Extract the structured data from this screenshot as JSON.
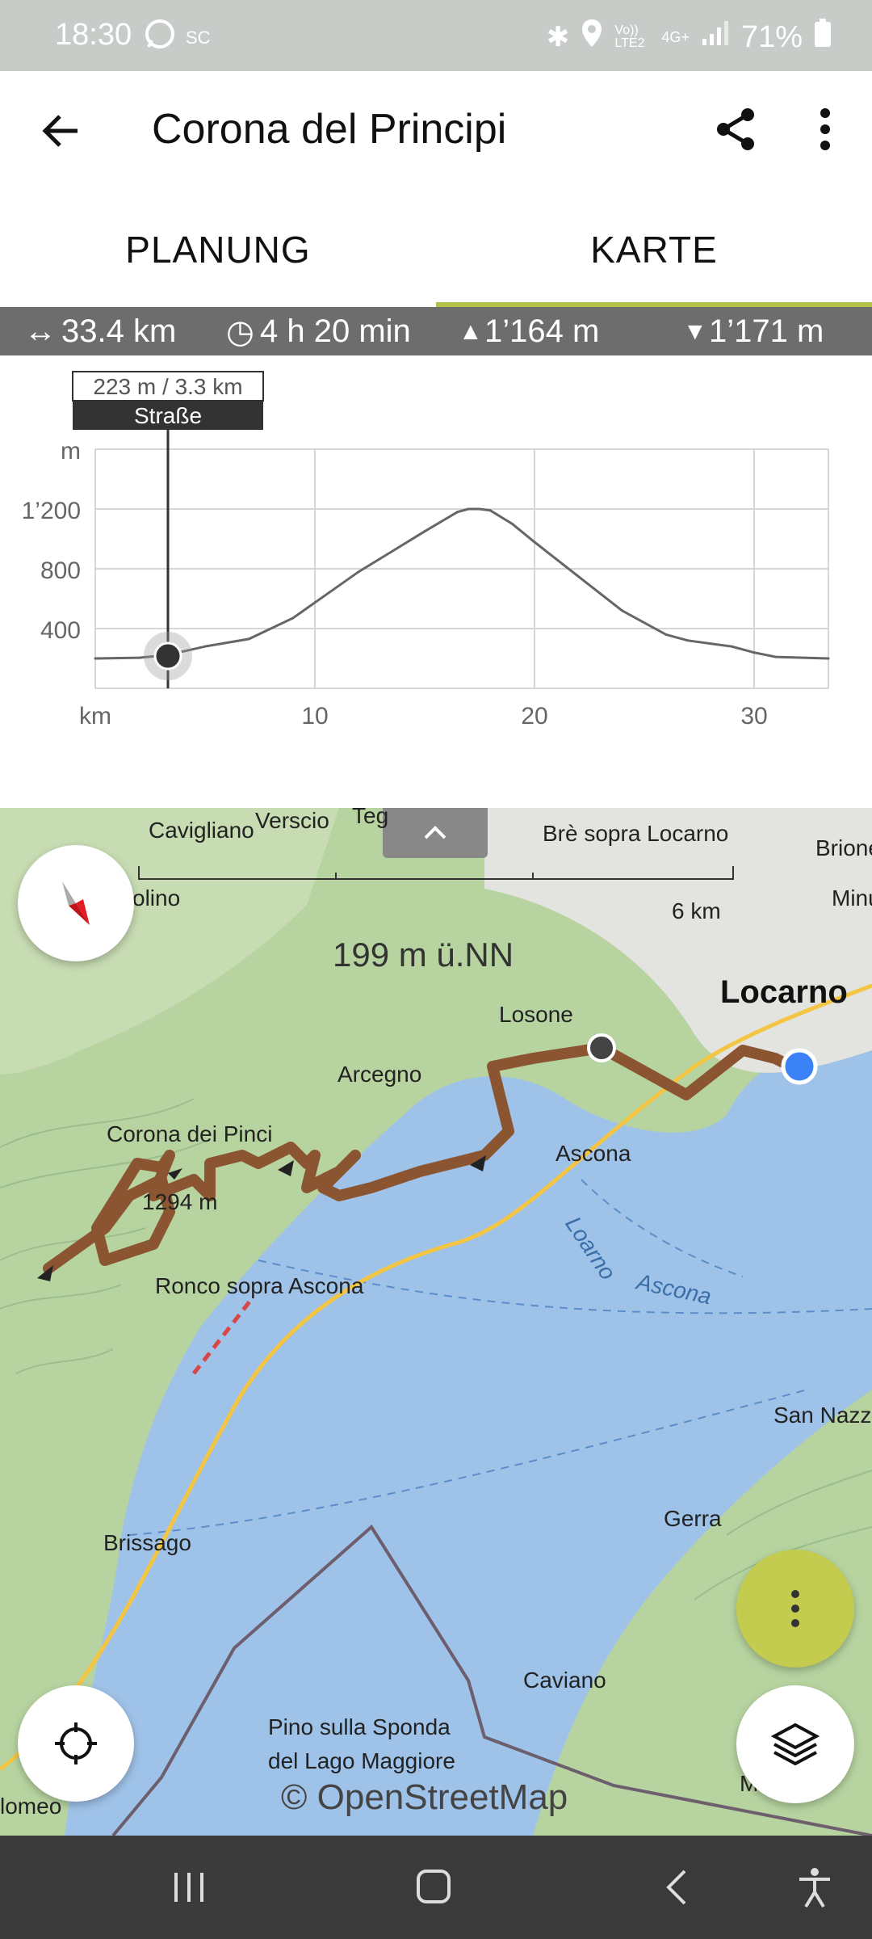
{
  "status": {
    "time": "18:30",
    "sc": "SC",
    "network": "Vo)) LTE2",
    "net2": "4G+",
    "battery": "71%"
  },
  "appbar": {
    "title": "Corona del Principi"
  },
  "tabs": [
    {
      "label": "PLANUNG"
    },
    {
      "label": "KARTE"
    }
  ],
  "stats": {
    "distance": "33.4 km",
    "duration": "4 h 20 min",
    "ascent": "1’164 m",
    "descent": "1’171 m"
  },
  "profile": {
    "tooltip_value": "223 m / 3.3 km",
    "tooltip_surface": "Straße",
    "y_unit": "m",
    "y_ticks": [
      "1’200",
      "800",
      "400"
    ],
    "x_unit": "km",
    "x_ticks": [
      "10",
      "20",
      "30"
    ]
  },
  "chart_data": {
    "type": "line",
    "xlabel": "km",
    "ylabel": "m",
    "xlim": [
      0,
      33.4
    ],
    "ylim": [
      0,
      1500
    ],
    "x": [
      0,
      2,
      3.3,
      5,
      7,
      9,
      12,
      15,
      16.5,
      17,
      17.5,
      18,
      19,
      20,
      22,
      24,
      26,
      27,
      29,
      30,
      31,
      33.4
    ],
    "y": [
      200,
      205,
      223,
      280,
      330,
      470,
      780,
      1050,
      1180,
      1200,
      1200,
      1190,
      1100,
      980,
      750,
      520,
      360,
      320,
      280,
      240,
      210,
      200
    ],
    "grid": true
  },
  "map": {
    "altitude_label": "199 m ü.NN",
    "scale_label": "6 km",
    "places": {
      "cavigliano": "Cavigliano",
      "verscio": "Verscio",
      "tegna": "Teg",
      "bre": "Brè sopra Locarno",
      "brione": "Brione",
      "minusio": "Minu",
      "olino": "olino",
      "locarno": "Locarno",
      "losone": "Losone",
      "arcegno": "Arcegno",
      "corona": "Corona dei Pinci",
      "peak": "1294 m",
      "ascona": "Ascona",
      "ronco": "Ronco sopra Ascona",
      "lake1": "Loarno",
      "lake2": "Ascona",
      "sannazzaro": "San Nazza",
      "gerra": "Gerra",
      "brissago": "Brissago",
      "caviano": "Caviano",
      "pino1": "Pino sulla Sponda",
      "pino2": "del Lago Maggiore",
      "lomeo": "lomeo",
      "veto": "Ma          eto"
    },
    "copyright": "© OpenStreetMap"
  },
  "icons": {
    "back": "arrow-left-icon",
    "share": "share-icon",
    "more": "more-vert-icon",
    "compass": "compass-icon",
    "locate": "crosshair-icon",
    "layers": "layers-icon"
  },
  "colors": {
    "accent": "#b5c24a",
    "route": "#8a5530",
    "stats_bg": "#6d6d6d",
    "lake": "#9fc2e8"
  }
}
